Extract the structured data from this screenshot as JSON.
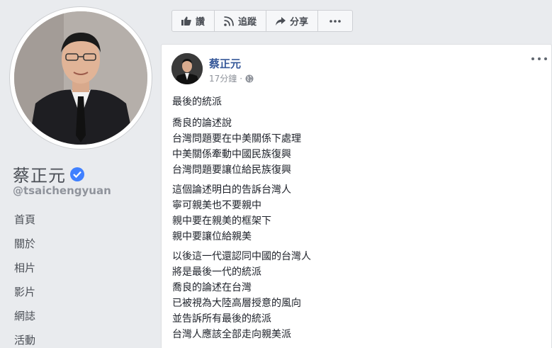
{
  "profile": {
    "name": "蔡正元",
    "username": "@tsaichengyuan",
    "nav": [
      "首頁",
      "關於",
      "相片",
      "影片",
      "網誌",
      "活動"
    ]
  },
  "actions": [
    {
      "label": "讚",
      "icon": "like-icon"
    },
    {
      "label": "追蹤",
      "icon": "rss-icon"
    },
    {
      "label": "分享",
      "icon": "share-icon"
    },
    {
      "label": "",
      "icon": "more-horizontal-icon"
    }
  ],
  "post": {
    "author": "蔡正元",
    "time": "17分鐘",
    "separator": "·",
    "privacy_icon": "globe-icon",
    "title": "最後的統派",
    "paragraphs": [
      [
        "喬良的論述說",
        "台灣問題要在中美關係下處理",
        "中美關係牽動中國民族復興",
        "台灣問題要讓位給民族復興"
      ],
      [
        "這個論述明白的告訴台灣人",
        "寧可親美也不要親中",
        "親中要在親美的框架下",
        "親中要讓位給親美"
      ],
      [
        "以後這一代還認同中國的台灣人",
        "將是最後一代的統派",
        "喬良的論述在台灣",
        "已被視為大陸高層授意的風向",
        "並告訴所有最後的統派",
        "台灣人應該全部走向親美派"
      ]
    ]
  },
  "colors": {
    "background": "#e9ebee",
    "link": "#365899",
    "verified": "#4080ff"
  }
}
